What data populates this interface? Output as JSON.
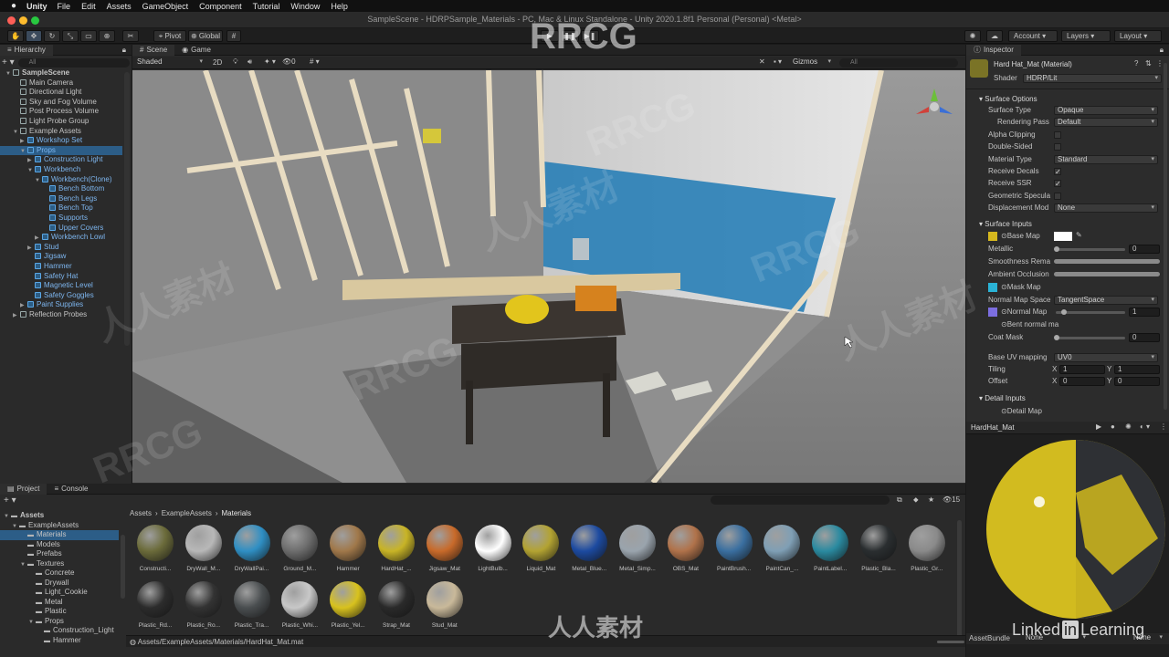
{
  "os_menu": {
    "app": "Unity",
    "items": [
      "File",
      "Edit",
      "Assets",
      "GameObject",
      "Component",
      "Tutorial",
      "Window",
      "Help"
    ]
  },
  "window_title": "SampleScene - HDRPSample_Materials - PC, Mac & Linux Standalone - Unity 2020.1.8f1 Personal (Personal) <Metal>",
  "toolbar": {
    "pivot": "Pivot",
    "global": "Global",
    "account": "Account",
    "layers": "Layers",
    "layout": "Layout"
  },
  "hierarchy": {
    "tab": "Hierarchy",
    "search_placeholder": "All",
    "rows": [
      {
        "label": "SampleScene",
        "indent": 0,
        "arrow": "▼",
        "bold": true,
        "icon": "unity"
      },
      {
        "label": "Main Camera",
        "indent": 1,
        "arrow": ""
      },
      {
        "label": "Directional Light",
        "indent": 1,
        "arrow": ""
      },
      {
        "label": "Sky and Fog Volume",
        "indent": 1,
        "arrow": ""
      },
      {
        "label": "Post Process Volume",
        "indent": 1,
        "arrow": ""
      },
      {
        "label": "Light Probe Group",
        "indent": 1,
        "arrow": ""
      },
      {
        "label": "Example Assets",
        "indent": 1,
        "arrow": "▼"
      },
      {
        "label": "Workshop Set",
        "indent": 2,
        "arrow": "▶",
        "blue": true
      },
      {
        "label": "Props",
        "indent": 2,
        "arrow": "▼",
        "blue": true,
        "selected": true
      },
      {
        "label": "Construction Light",
        "indent": 3,
        "arrow": "▶",
        "blue": true
      },
      {
        "label": "Workbench",
        "indent": 3,
        "arrow": "▼",
        "blue": true
      },
      {
        "label": "Workbench(Clone)",
        "indent": 4,
        "arrow": "▼",
        "blue": true
      },
      {
        "label": "Bench Bottom",
        "indent": 5,
        "arrow": "",
        "blue": true
      },
      {
        "label": "Bench Legs",
        "indent": 5,
        "arrow": "",
        "blue": true
      },
      {
        "label": "Bench Top",
        "indent": 5,
        "arrow": "",
        "blue": true
      },
      {
        "label": "Supports",
        "indent": 5,
        "arrow": "",
        "blue": true
      },
      {
        "label": "Upper Covers",
        "indent": 5,
        "arrow": "",
        "blue": true
      },
      {
        "label": "Workbench Lowl",
        "indent": 4,
        "arrow": "▶",
        "blue": true
      },
      {
        "label": "Stud",
        "indent": 3,
        "arrow": "▶",
        "blue": true
      },
      {
        "label": "Jigsaw",
        "indent": 3,
        "arrow": "",
        "blue": true
      },
      {
        "label": "Hammer",
        "indent": 3,
        "arrow": "",
        "blue": true
      },
      {
        "label": "Safety Hat",
        "indent": 3,
        "arrow": "",
        "blue": true
      },
      {
        "label": "Magnetic Level",
        "indent": 3,
        "arrow": "",
        "blue": true
      },
      {
        "label": "Safety Goggles",
        "indent": 3,
        "arrow": "",
        "blue": true
      },
      {
        "label": "Paint Supplies",
        "indent": 2,
        "arrow": "▶",
        "blue": true
      },
      {
        "label": "Reflection Probes",
        "indent": 1,
        "arrow": "▶"
      }
    ]
  },
  "scene_view": {
    "tabs": [
      "Scene",
      "Game"
    ],
    "shading": "Shaded",
    "mode_2d": "2D",
    "gizmos": "Gizmos",
    "search_placeholder": "All",
    "fx_count": "0"
  },
  "inspector": {
    "tab": "Inspector",
    "material_name": "Hard Hat_Mat (Material)",
    "shader_label": "Shader",
    "shader_value": "HDRP/Lit",
    "surface_options": "Surface Options",
    "fields": [
      {
        "label": "Surface Type",
        "type": "dropdown",
        "value": "Opaque"
      },
      {
        "label": "Rendering Pass",
        "type": "dropdown",
        "value": "Default",
        "indent": true
      },
      {
        "label": "Alpha Clipping",
        "type": "check",
        "value": ""
      },
      {
        "label": "Double-Sided",
        "type": "check",
        "value": ""
      },
      {
        "label": "Material Type",
        "type": "dropdown",
        "value": "Standard"
      },
      {
        "label": "Receive Decals",
        "type": "check",
        "value": "✓"
      },
      {
        "label": "Receive SSR",
        "type": "check",
        "value": "✓"
      },
      {
        "label": "Geometric Specula",
        "type": "check",
        "value": ""
      },
      {
        "label": "Displacement Mod",
        "type": "dropdown",
        "value": "None"
      }
    ],
    "surface_inputs": "Surface Inputs",
    "inputs": [
      {
        "label": "Base Map",
        "kind": "color"
      },
      {
        "label": "Metallic",
        "kind": "slider",
        "value": "0",
        "fraction": 0.0
      },
      {
        "label": "Smoothness Rema",
        "kind": "range"
      },
      {
        "label": "Ambient Occlusion",
        "kind": "range"
      },
      {
        "label": "Mask Map",
        "kind": "texture"
      },
      {
        "label": "Normal Map Space",
        "kind": "dropdown",
        "value": "TangentSpace"
      },
      {
        "label": "Normal Map",
        "kind": "slider",
        "value": "1",
        "fraction": 0.1
      },
      {
        "label": "Bent normal ma",
        "kind": "texture"
      },
      {
        "label": "Coat Mask",
        "kind": "slider",
        "value": "0",
        "fraction": 0.0
      }
    ],
    "uv_label": "Base UV mapping",
    "uv_value": "UV0",
    "tiling_label": "Tiling",
    "tiling_x": "1",
    "tiling_y": "1",
    "offset_label": "Offset",
    "offset_x": "0",
    "offset_y": "0",
    "x_label": "X",
    "y_label": "Y",
    "detail_inputs": "Detail Inputs",
    "detail_map": "Detail Map",
    "preview_title": "HardHat_Mat",
    "asset_bundle_label": "AssetBundle",
    "asset_bundle_value": "None",
    "asset_bundle_variant": "None"
  },
  "project": {
    "tabs": [
      "Project",
      "Console"
    ],
    "breadcrumb": [
      "Assets",
      "ExampleAssets",
      "Materials"
    ],
    "item_count": "15",
    "tree": [
      {
        "label": "Assets",
        "indent": 0,
        "arrow": "▼",
        "bold": true
      },
      {
        "label": "ExampleAssets",
        "indent": 1,
        "arrow": "▼"
      },
      {
        "label": "Materials",
        "indent": 2,
        "arrow": "",
        "selected": true
      },
      {
        "label": "Models",
        "indent": 2,
        "arrow": ""
      },
      {
        "label": "Prefabs",
        "indent": 2,
        "arrow": ""
      },
      {
        "label": "Textures",
        "indent": 2,
        "arrow": "▼"
      },
      {
        "label": "Concrete",
        "indent": 3,
        "arrow": ""
      },
      {
        "label": "Drywall",
        "indent": 3,
        "arrow": ""
      },
      {
        "label": "Light_Cookie",
        "indent": 3,
        "arrow": ""
      },
      {
        "label": "Metal",
        "indent": 3,
        "arrow": ""
      },
      {
        "label": "Plastic",
        "indent": 3,
        "arrow": ""
      },
      {
        "label": "Props",
        "indent": 3,
        "arrow": "▼"
      },
      {
        "label": "Construction_Light",
        "indent": 4,
        "arrow": ""
      },
      {
        "label": "Hammer",
        "indent": 4,
        "arrow": ""
      }
    ],
    "materials": [
      {
        "name": "Constructi...",
        "color": "#6b6b3a"
      },
      {
        "name": "DryWall_M...",
        "color": "#b8b8b8"
      },
      {
        "name": "DryWallPai...",
        "color": "#2f8fc4"
      },
      {
        "name": "Ground_M...",
        "color": "#6d6d6d"
      },
      {
        "name": "Hammer",
        "color": "#a0784a"
      },
      {
        "name": "HardHat_...",
        "color": "#c8b426"
      },
      {
        "name": "Jigsaw_Mat",
        "color": "#c86a2a"
      },
      {
        "name": "LightBulb...",
        "color": "#ffffff"
      },
      {
        "name": "Liquid_Mat",
        "color": "#b3a332"
      },
      {
        "name": "Metal_Blue...",
        "color": "#1c4aa0"
      },
      {
        "name": "Metal_Simp...",
        "color": "#9aa4ad"
      },
      {
        "name": "OBS_Mat",
        "color": "#b0724a"
      },
      {
        "name": "PaintBrush...",
        "color": "#3a6fa0"
      },
      {
        "name": "PaintCan_...",
        "color": "#7f9fb5"
      },
      {
        "name": "PaintLabel...",
        "color": "#2a8aa0"
      },
      {
        "name": "Plastic_Bla...",
        "color": "#2a2e30"
      },
      {
        "name": "Plastic_Gr...",
        "color": "#8a8a8a"
      },
      {
        "name": "Plastic_Rd...",
        "color": "#2c2c2c"
      },
      {
        "name": "Plastic_Ro...",
        "color": "#333"
      },
      {
        "name": "Plastic_Tra...",
        "color": "#4a4e50"
      },
      {
        "name": "Plastic_Whi...",
        "color": "#c8c8c8"
      },
      {
        "name": "Plastic_Yel...",
        "color": "#d8c21e"
      },
      {
        "name": "Strap_Mat",
        "color": "#2a2a2a"
      },
      {
        "name": "Stud_Mat",
        "color": "#c9b99a"
      }
    ],
    "status_path": "Assets/ExampleAssets/Materials/HardHat_Mat.mat"
  },
  "watermarks": {
    "brand": "RRCG",
    "cn": "人人素材",
    "linkedin": "Linked",
    "in": "in",
    "learning": "Learning"
  }
}
